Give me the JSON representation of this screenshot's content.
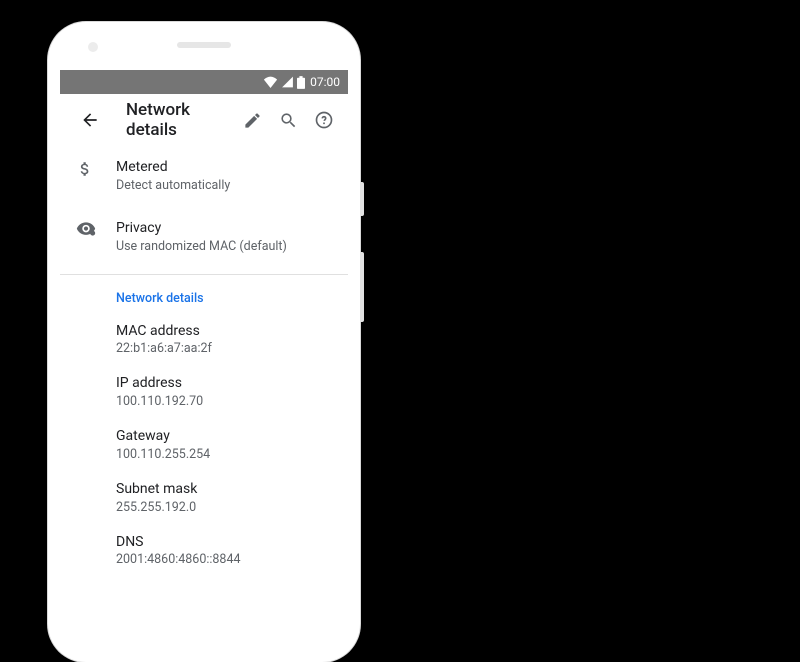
{
  "statusbar": {
    "time": "07:00"
  },
  "appbar": {
    "title": "Network details"
  },
  "settings": {
    "metered": {
      "title": "Metered",
      "sub": "Detect automatically"
    },
    "privacy": {
      "title": "Privacy",
      "sub": "Use randomized MAC (default)"
    }
  },
  "section_header": "Network details",
  "details": {
    "mac": {
      "title": "MAC address",
      "value": "22:b1:a6:a7:aa:2f"
    },
    "ip": {
      "title": "IP address",
      "value": "100.110.192.70"
    },
    "gateway": {
      "title": "Gateway",
      "value": "100.110.255.254"
    },
    "subnet": {
      "title": "Subnet mask",
      "value": "255.255.192.0"
    },
    "dns": {
      "title": "DNS",
      "value": "2001:4860:4860::8844"
    }
  }
}
